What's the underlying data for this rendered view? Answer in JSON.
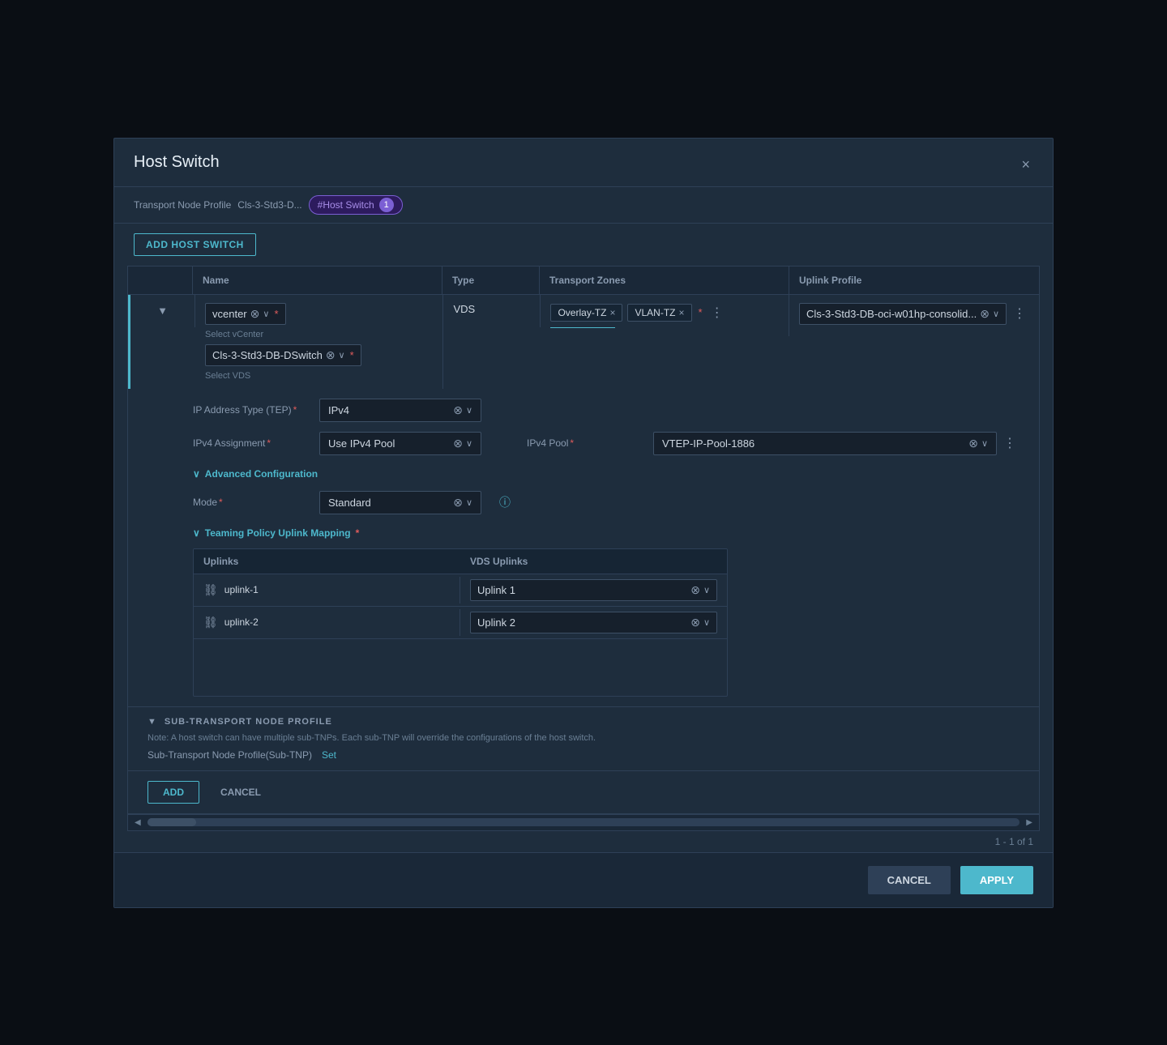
{
  "modal": {
    "title": "Host Switch",
    "close_label": "×"
  },
  "breadcrumb": {
    "label": "Transport Node Profile",
    "value": "Cls-3-Std3-D...",
    "badge_text": "#Host Switch",
    "badge_count": "1"
  },
  "toolbar": {
    "add_host_switch_label": "ADD HOST SWITCH"
  },
  "table": {
    "columns": {
      "name": "Name",
      "type": "Type",
      "transport_zones": "Transport Zones",
      "uplink_profile": "Uplink Profile"
    }
  },
  "row": {
    "vcenter_label": "vcenter",
    "vcenter_hint": "Select vCenter",
    "vds_label": "Cls-3-Std3-DB-DSwitch",
    "vds_hint": "Select VDS",
    "type": "VDS",
    "transport_zones": [
      {
        "label": "Overlay-TZ"
      },
      {
        "label": "VLAN-TZ"
      }
    ],
    "uplink_profile": "Cls-3-Std3-DB-oci-w01hp-consolid...",
    "ip_address_type_label": "IP Address Type (TEP)",
    "ip_address_type_value": "IPv4",
    "ipv4_assignment_label": "IPv4 Assignment",
    "ipv4_assignment_value": "Use IPv4 Pool",
    "ipv4_pool_label": "IPv4 Pool",
    "ipv4_pool_value": "VTEP-IP-Pool-1886"
  },
  "advanced": {
    "toggle_label": "Advanced Configuration",
    "mode_label": "Mode",
    "mode_value": "Standard"
  },
  "teaming": {
    "toggle_label": "Teaming Policy Uplink Mapping",
    "uplinks_col": "Uplinks",
    "vds_uplinks_col": "VDS Uplinks",
    "rows": [
      {
        "name": "uplink-1",
        "vds_uplink": "Uplink 1"
      },
      {
        "name": "uplink-2",
        "vds_uplink": "Uplink 2"
      }
    ]
  },
  "sub_transport": {
    "title": "SUB-TRANSPORT NODE PROFILE",
    "note": "Note: A host switch can have multiple sub-TNPs. Each sub-TNP will override the configurations of the host switch.",
    "label": "Sub-Transport Node Profile(Sub-TNP)",
    "action": "Set"
  },
  "action_bar": {
    "add_label": "ADD",
    "cancel_label": "CANCEL"
  },
  "scrollbar": {
    "arrow_left": "◀",
    "arrow_right": "▶"
  },
  "pagination": {
    "text": "1 - 1 of 1"
  },
  "footer": {
    "cancel_label": "CANCEL",
    "apply_label": "APPLY"
  }
}
